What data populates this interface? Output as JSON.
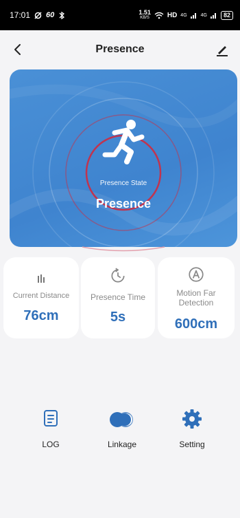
{
  "status_bar": {
    "time": "17:01",
    "left_extra": "60",
    "speed_value": "1.51",
    "speed_unit": "KB/S",
    "hd_label": "HD",
    "net1": "4G",
    "net2": "4G",
    "battery": "82"
  },
  "header": {
    "title": "Presence"
  },
  "presence": {
    "state_label": "Presence State",
    "state_value": "Presence",
    "accent_ring_color": "#c0344f",
    "card_color": "#4a90d6"
  },
  "info_cards": [
    {
      "label": "Current Distance",
      "value": "76cm"
    },
    {
      "label": "Presence Time",
      "value": "5s"
    },
    {
      "label_line1": "Motion Far",
      "label_line2": "Detection",
      "value": "600cm"
    }
  ],
  "actions": [
    {
      "label": "LOG",
      "icon": "document-icon"
    },
    {
      "label": "Linkage",
      "icon": "toggle-icon"
    },
    {
      "label": "Setting",
      "icon": "gear-icon"
    }
  ],
  "colors": {
    "value_blue": "#2f6fb9",
    "icon_blue": "#2f6fb9"
  }
}
